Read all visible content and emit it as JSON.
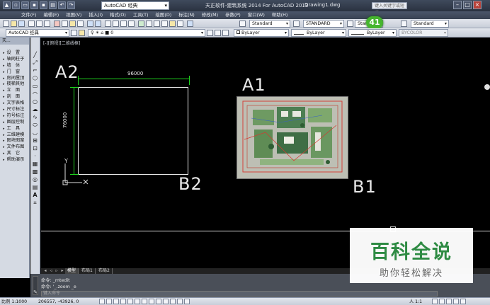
{
  "titlebar": {
    "workspace": "AutoCAD 经典",
    "app_title": "天正软件-建筑系统 2014  For AutoCAD 2013",
    "document": "Drawing1.dwg",
    "help_search_placeholder": "键入关键字或短语"
  },
  "menu": [
    "文件(F)",
    "编辑(E)",
    "视图(V)",
    "插入(I)",
    "格式(O)",
    "工具(T)",
    "绘图(D)",
    "标注(N)",
    "修改(M)",
    "参数(P)",
    "窗口(W)",
    "帮助(H)"
  ],
  "toolbar1": {
    "text_style": "Standard",
    "dim_style": "STANDARD",
    "table_style": "Standard",
    "mleader_style": "Standard"
  },
  "toolbar2": {
    "workspace": "AutoCAD 经典",
    "layer": "0",
    "color": "ByLayer",
    "linetype": "ByLayer",
    "lineweight": "ByLayer",
    "plotstyle": "BYCOLOR"
  },
  "badge": "41",
  "palette": {
    "header": "天...",
    "items": [
      "设　置",
      "轴网柱子",
      "墙　体",
      "门　窗",
      "房间屋顶",
      "楼梯其他",
      "立　面",
      "剖　面",
      "文字表格",
      "尺寸标注",
      "符号标注",
      "图层控制",
      "工　具",
      "三维建模",
      "图块图案",
      "文件布图",
      "其　它",
      "帮助演示"
    ]
  },
  "viewport_label": "[-][俯视][二维线框]",
  "drawing": {
    "labels": {
      "a2": "A2",
      "b2": "B2",
      "a1": "A1",
      "b1": "B1"
    },
    "dim_h": "96000",
    "dim_v": "76000",
    "ucs_y": "Y"
  },
  "tabs": [
    "模型",
    "布局1",
    "布局2"
  ],
  "command": {
    "lines": [
      "命令: _mtedit",
      "命令: '_.zoom _e"
    ],
    "placeholder": "键入命令"
  },
  "status": {
    "scale": "比例 1:1000",
    "coords": "206557, -43926, 0",
    "anno_scale": "人 1:1"
  },
  "watermark": {
    "title": "百科全说",
    "subtitle": "助你轻松解决"
  },
  "colors": {
    "canvas": "#000000",
    "dimension": "#1fd21f",
    "watermark_green": "#2e8b43"
  }
}
